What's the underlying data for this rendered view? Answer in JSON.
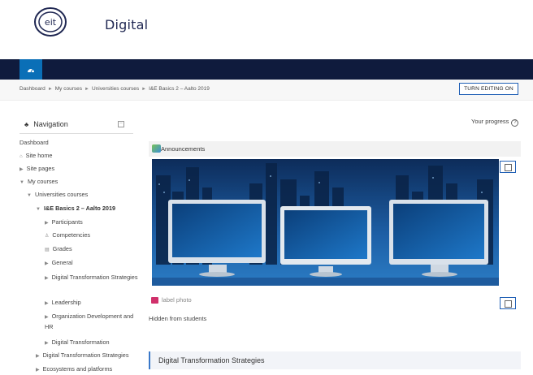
{
  "brand": {
    "logo_mark": "eit",
    "logo_text": "Digital"
  },
  "navbar": {
    "home_icon": "dashboard-icon"
  },
  "breadcrumb": [
    "Dashboard",
    "My courses",
    "Universities courses",
    "I&E Basics 2 – Aalto 2019"
  ],
  "header": {
    "edit_button": "TURN EDITING ON"
  },
  "navigation": {
    "title": "Navigation",
    "items": [
      {
        "label": "Dashboard"
      },
      {
        "label": "Site home"
      },
      {
        "label": "Site pages"
      },
      {
        "label": "My courses"
      },
      {
        "label": "Universities courses"
      },
      {
        "label": "I&E Basics 2 – Aalto 2019"
      },
      {
        "label": "Participants"
      },
      {
        "label": "Competencies"
      },
      {
        "label": "Grades"
      },
      {
        "label": "General"
      },
      {
        "label": "Digital Transformation Strategies"
      },
      {
        "label": "Leadership"
      },
      {
        "label": "Organization Development and HR"
      },
      {
        "label": "Digital Transformation"
      },
      {
        "label": "Digital Transformation Strategies"
      },
      {
        "label": "Ecosystems and platforms"
      }
    ]
  },
  "main": {
    "progress_label": "Your progress",
    "progress_help": "?",
    "announcements": "Announcements",
    "label_photo": "label photo",
    "hidden_note": "Hidden from students",
    "section_title": "Digital Transformation Strategies"
  }
}
